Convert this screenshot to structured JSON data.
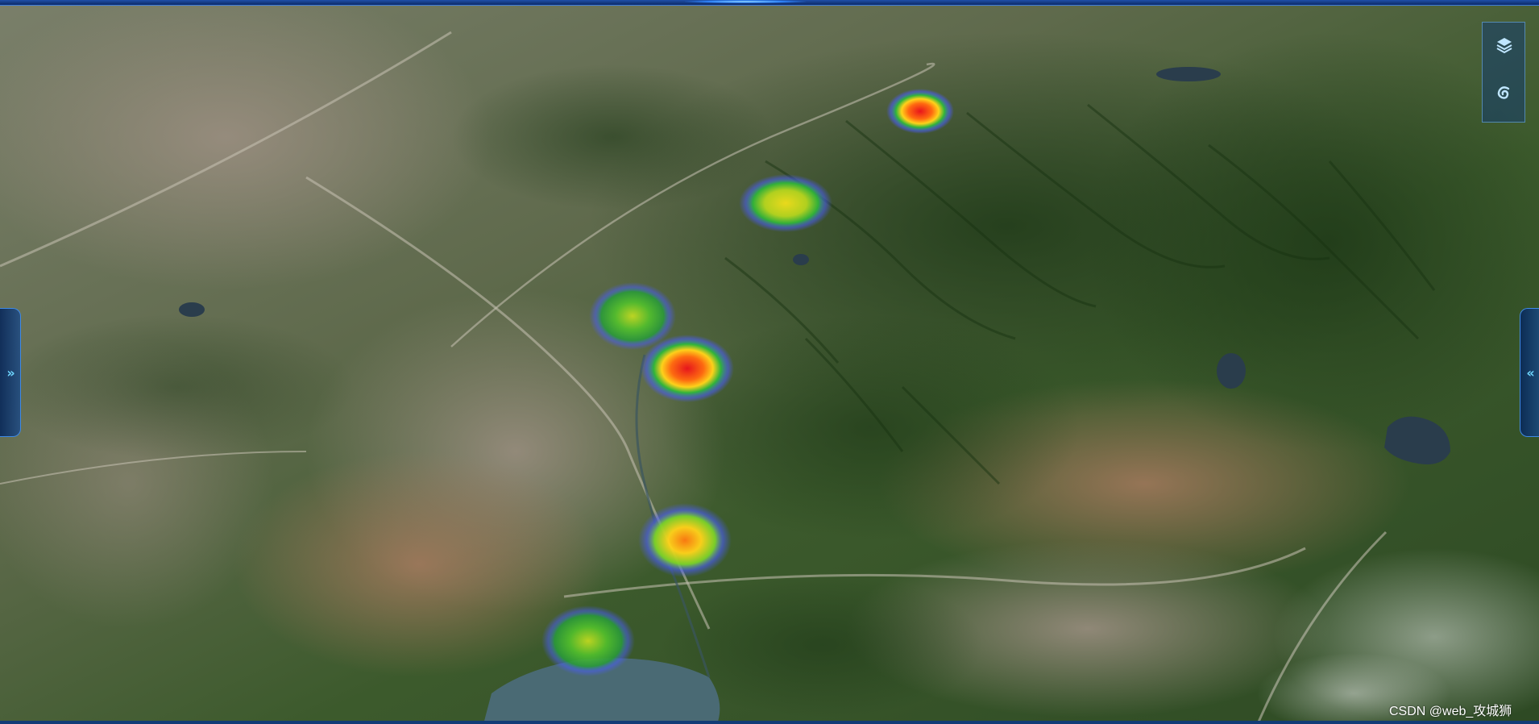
{
  "map": {
    "basemap": "satellite-imagery-terrain",
    "overlay": "heatmap",
    "heatmap_points": [
      {
        "id": "hotspot-1",
        "intensity": 1.0
      },
      {
        "id": "hotspot-2",
        "intensity": 0.75
      },
      {
        "id": "hotspot-3",
        "intensity": 0.6
      },
      {
        "id": "hotspot-4",
        "intensity": 0.95
      },
      {
        "id": "hotspot-5",
        "intensity": 0.85
      },
      {
        "id": "hotspot-6",
        "intensity": 0.6
      }
    ],
    "colors": {
      "heat_high": "#e8141c",
      "heat_mid": "#ffd21a",
      "heat_low": "#2fb53a",
      "heat_edge": "#4a5cff",
      "ui_accent": "#3f8ae6"
    }
  },
  "toolbar": {
    "layers_icon": "layers-icon",
    "reset_icon": "swirl-icon"
  },
  "side_panels": {
    "left_toggle": "»",
    "right_toggle": "«"
  },
  "watermark": "CSDN @web_攻城狮"
}
